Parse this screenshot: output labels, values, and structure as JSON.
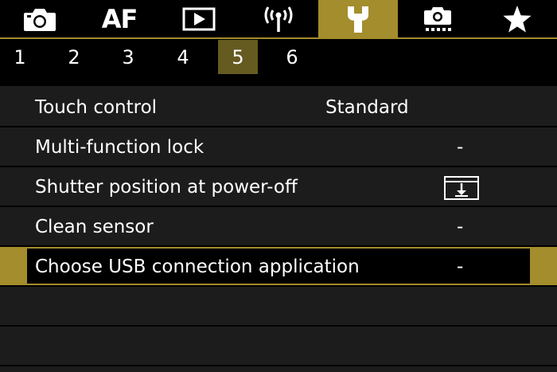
{
  "tabs": [
    {
      "name": "shooting",
      "icon": "camera-icon",
      "label": ""
    },
    {
      "name": "af",
      "icon": "",
      "label": "AF"
    },
    {
      "name": "playback",
      "icon": "play-icon",
      "label": ""
    },
    {
      "name": "wireless",
      "icon": "wireless-icon",
      "label": ""
    },
    {
      "name": "setup",
      "icon": "wrench-icon",
      "label": "",
      "active": true
    },
    {
      "name": "custom",
      "icon": "camera-settings-icon",
      "label": ""
    },
    {
      "name": "mymenu",
      "icon": "star-icon",
      "label": ""
    }
  ],
  "pages": [
    "1",
    "2",
    "3",
    "4",
    "5",
    "6"
  ],
  "active_page": "5",
  "menu": {
    "items": [
      {
        "label": "Touch control",
        "value": "Standard"
      },
      {
        "label": "Multi-function lock",
        "value": "-"
      },
      {
        "label": "Shutter position at power-off",
        "value": "",
        "value_icon": "shutter-closed-icon"
      },
      {
        "label": "Clean sensor",
        "value": "-"
      },
      {
        "label": "Choose USB connection application",
        "value": "-",
        "selected": true
      }
    ]
  },
  "colors": {
    "accent": "#a38d2c",
    "active_page": "#655a20",
    "row_bg": "#1c1c1c",
    "background": "#000000"
  }
}
